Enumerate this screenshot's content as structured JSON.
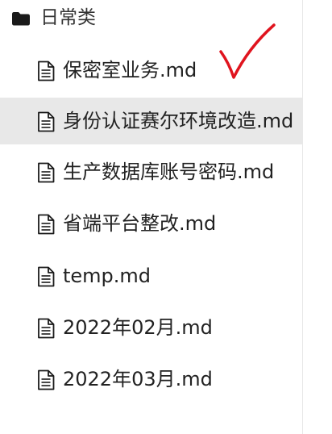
{
  "folder": {
    "name": "日常类",
    "icon": "folder-icon"
  },
  "files": [
    {
      "name": "保密室业务.md",
      "icon": "document-icon",
      "selected": false
    },
    {
      "name": "身份认证赛尔环境改造.md",
      "icon": "document-icon",
      "selected": true
    },
    {
      "name": "生产数据库账号密码.md",
      "icon": "document-icon",
      "selected": false
    },
    {
      "name": "省端平台整改.md",
      "icon": "document-icon",
      "selected": false
    },
    {
      "name": "temp.md",
      "icon": "document-icon",
      "selected": false
    },
    {
      "name": "2022年02月.md",
      "icon": "document-icon",
      "selected": false
    },
    {
      "name": "2022年03月.md",
      "icon": "document-icon",
      "selected": false
    }
  ],
  "annotation": {
    "type": "red-checkmark",
    "color": "#e0141e"
  },
  "colors": {
    "selected_row": "#e8e8e8",
    "text": "#222222",
    "icon": "#1a1a1a"
  }
}
